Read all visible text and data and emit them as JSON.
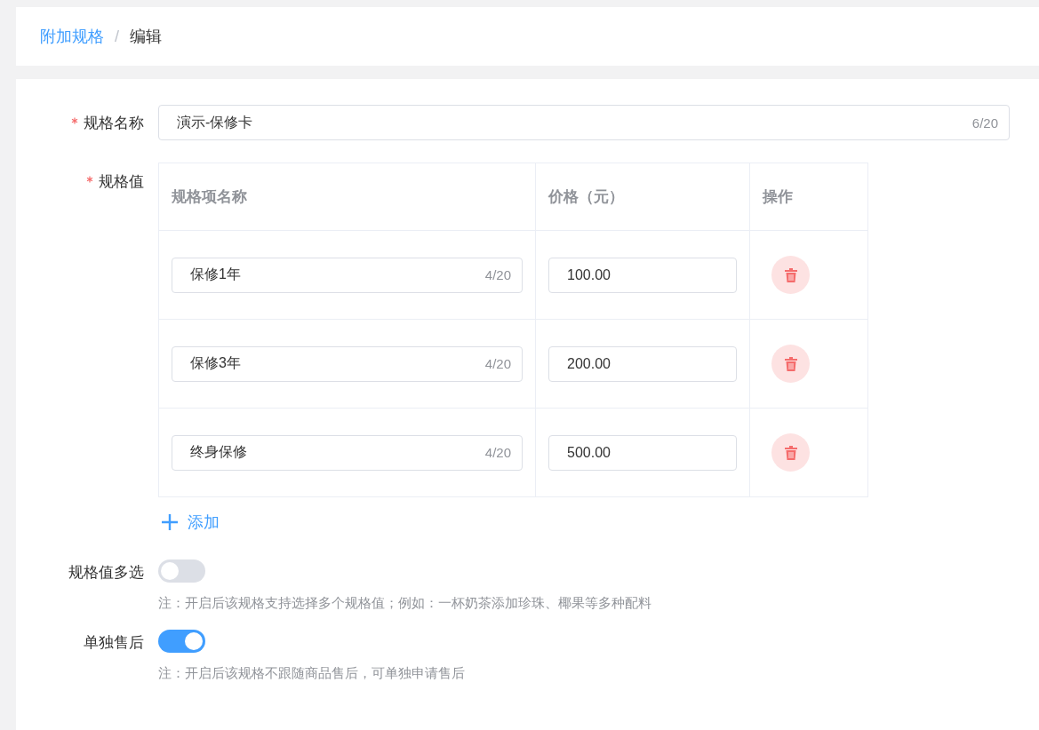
{
  "breadcrumb": {
    "items": [
      {
        "label": "附加规格",
        "link": true
      },
      {
        "label": "编辑",
        "link": false
      }
    ],
    "separator": "/"
  },
  "name_field": {
    "label": "规格名称",
    "required": true,
    "value": "演示-保修卡",
    "count": "6/20"
  },
  "spec_values": {
    "label": "规格值",
    "required": true,
    "columns": [
      "规格项名称",
      "价格（元）",
      "操作"
    ],
    "rows": [
      {
        "name": "保修1年",
        "count": "4/20",
        "price": "100.00"
      },
      {
        "name": "保修3年",
        "count": "4/20",
        "price": "200.00"
      },
      {
        "name": "终身保修",
        "count": "4/20",
        "price": "500.00"
      }
    ],
    "add_button": "添加"
  },
  "switches": [
    {
      "label": "规格值多选",
      "on": false,
      "note": "注：开启后该规格支持选择多个规格值；例如：一杯奶茶添加珍珠、椰果等多种配料"
    },
    {
      "label": "单独售后",
      "on": true,
      "note": "注：开启后该规格不跟随商品售后，可单独申请售后"
    }
  ]
}
